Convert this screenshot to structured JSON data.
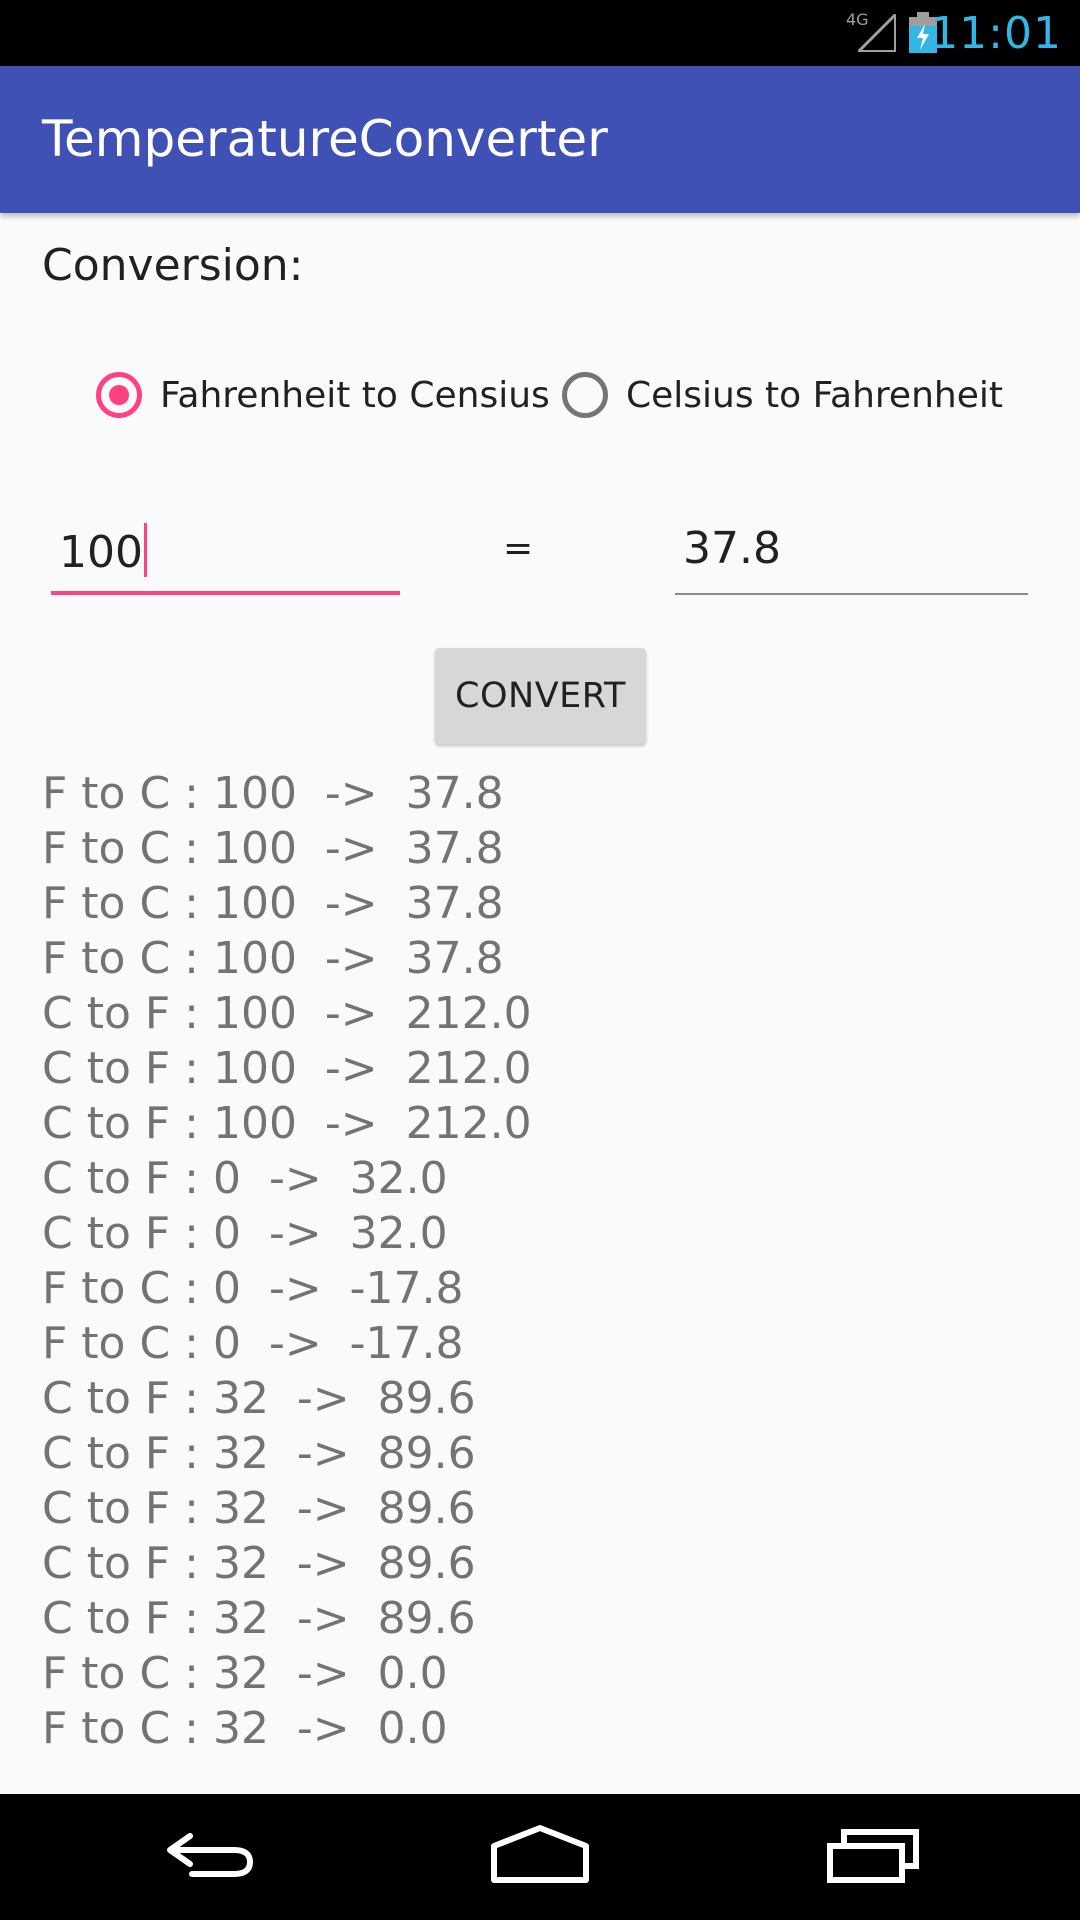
{
  "status_bar": {
    "network": "4G",
    "time": "11:01",
    "icons": [
      "signal-icon",
      "battery-icon"
    ],
    "time_color": "#33b5e5"
  },
  "app_bar": {
    "title": "TemperatureConverter",
    "color": "#3f51b5"
  },
  "conversion": {
    "label": "Conversion:",
    "options": [
      {
        "label": "Fahrenheit to Censius",
        "checked": true
      },
      {
        "label": "Celsius to Fahrenheit",
        "checked": false
      }
    ],
    "accent_color": "#ff4081"
  },
  "input": {
    "value": "100",
    "equals": "=",
    "result": "37.8"
  },
  "convert_button": {
    "label": "CONVERT"
  },
  "history": [
    "F to C : 100  ->  37.8",
    "F to C : 100  ->  37.8",
    "F to C : 100  ->  37.8",
    "F to C : 100  ->  37.8",
    "C to F : 100  ->  212.0",
    "C to F : 100  ->  212.0",
    "C to F : 100  ->  212.0",
    "C to F : 0  ->  32.0",
    "C to F : 0  ->  32.0",
    "F to C : 0  ->  -17.8",
    "F to C : 0  ->  -17.8",
    "C to F : 32  ->  89.6",
    "C to F : 32  ->  89.6",
    "C to F : 32  ->  89.6",
    "C to F : 32  ->  89.6",
    "C to F : 32  ->  89.6",
    "F to C : 32  ->  0.0",
    "F to C : 32  ->  0.0"
  ],
  "nav_bar": {
    "icons": [
      "back-icon",
      "home-icon",
      "recent-apps-icon"
    ]
  }
}
